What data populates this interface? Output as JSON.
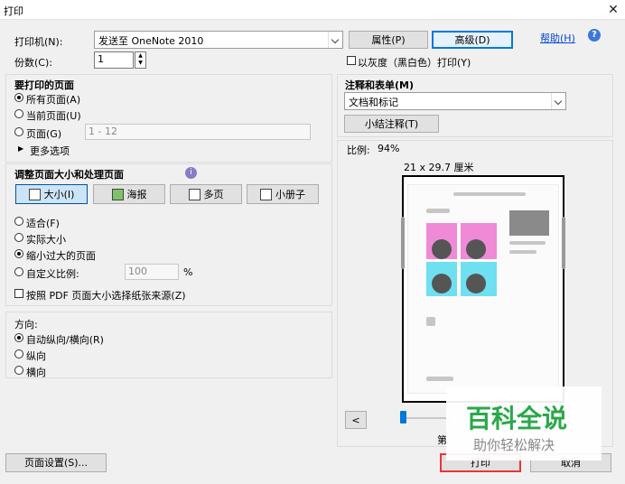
{
  "window": {
    "title": "打印",
    "close": "✕"
  },
  "printer": {
    "label": "打印机(N):",
    "value": "发送至 OneNote 2010",
    "properties": "属性(P)",
    "advanced": "高级(D)",
    "help": "帮助(H)"
  },
  "copies": {
    "label": "份数(C):",
    "value": "1"
  },
  "grayscale": {
    "label": "以灰度（黑白色）打印(Y)",
    "checked": false
  },
  "pages": {
    "heading": "要打印的页面",
    "all": "所有页面(A)",
    "current": "当前页面(U)",
    "range_label": "页面(G)",
    "range_value": "1 - 12",
    "more": "更多选项",
    "selected": "all"
  },
  "sizing": {
    "heading": "调整页面大小和处理页面",
    "modes": [
      "大小(I)",
      "海报",
      "多页",
      "小册子"
    ],
    "selected_mode": 0,
    "options": [
      "适合(F)",
      "实际大小",
      "缩小过大的页面",
      "自定义比例:"
    ],
    "selected_option": 2,
    "scale_value": "100",
    "scale_unit": "%",
    "paper_source": "按照 PDF 页面大小选择纸张来源(Z)"
  },
  "orientation": {
    "heading": "方向:",
    "options": [
      "自动纵向/横向(R)",
      "纵向",
      "横向"
    ],
    "selected": 0
  },
  "comments": {
    "heading": "注释和表单(M)",
    "value": "文档和标记",
    "summarize": "小结注释(T)"
  },
  "preview": {
    "scale_label": "比例:",
    "scale_value": "94%",
    "paper_size": "21 x 29.7 厘米",
    "page_prefix": "第",
    "nav_prev": "<",
    "slider_fraction": 0.06
  },
  "footer": {
    "page_setup": "页面设置(S)...",
    "print": "打印",
    "cancel": "取消"
  },
  "watermark": {
    "title": "百科全说",
    "subtitle": "助你轻松解决"
  },
  "colors": {
    "accent": "#0078d7",
    "watermark_green": "#2aa84a",
    "pink": "#f08ad6",
    "cyan": "#6ee0f0"
  }
}
